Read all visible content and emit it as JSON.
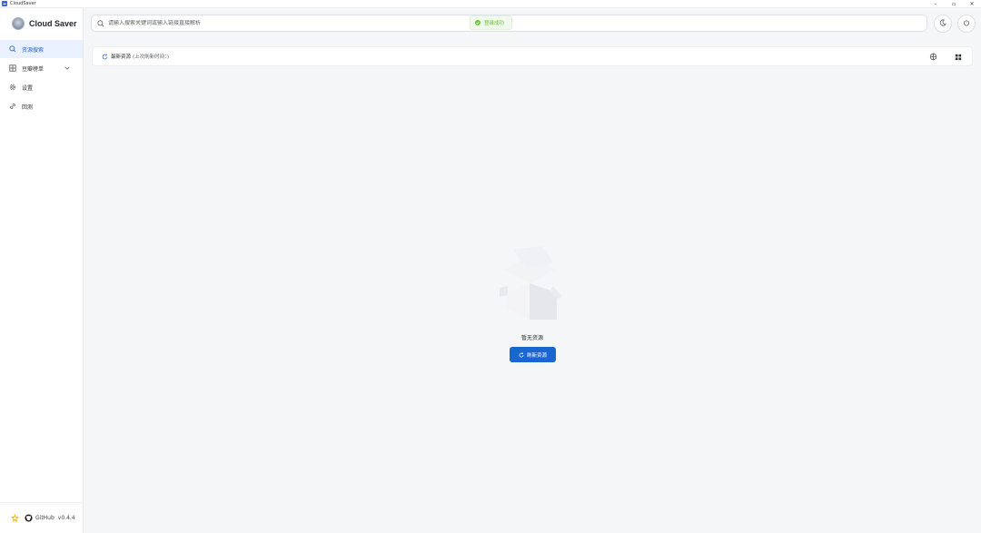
{
  "window": {
    "title": "CloudSaver",
    "controls": [
      "–",
      "▫",
      "✕"
    ]
  },
  "brand": {
    "name": "Cloud Saver"
  },
  "sidebar": {
    "items": [
      {
        "label": "资源搜索",
        "icon": "search-icon",
        "active": true
      },
      {
        "label": "豆瓣榜单",
        "icon": "grid-icon",
        "active": false,
        "expandable": true
      },
      {
        "label": "设置",
        "icon": "gear-icon",
        "active": false
      },
      {
        "label": "回测",
        "icon": "link-icon",
        "active": false
      }
    ],
    "footer": {
      "github_label": "GitHub",
      "version": "v0.4.4"
    }
  },
  "search": {
    "placeholder": "请输入搜索关键词或输入链接直接解析",
    "value": ""
  },
  "toast": {
    "text": "登录成功",
    "color": "#67c23a"
  },
  "toolbar": {
    "latest_label": "最新资源",
    "last_refresh": "(上次刷新时间：)"
  },
  "empty_state": {
    "text": "暂无资源",
    "button_label": "刷新资源"
  },
  "colors": {
    "accent": "#1867d0",
    "active_bg": "#e8f1fd",
    "success": "#67c23a"
  }
}
